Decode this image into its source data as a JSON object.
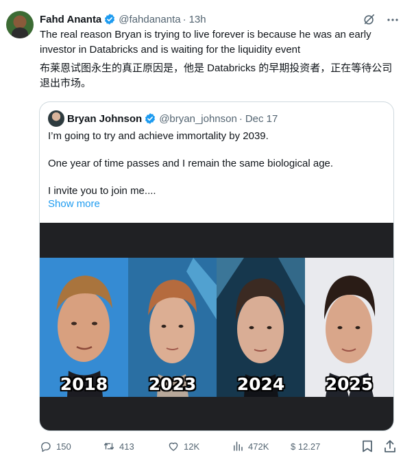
{
  "tweet": {
    "author_name": "Fahd Ananta",
    "author_handle": "@fahdananta",
    "separator": "·",
    "time": "13h",
    "text_en": "The real reason Bryan is trying to live forever is because he was an early investor in Databricks and is waiting for the liquidity event",
    "text_zh": "布莱恩试图永生的真正原因是，他是 Databricks 的早期投资者，正在等待公司退出市场。",
    "icons": {
      "verified": "verified-badge-icon",
      "grok": "grok-icon",
      "more": "more-icon"
    }
  },
  "quote": {
    "author_name": "Bryan Johnson",
    "author_handle": "@bryan_johnson",
    "separator": "·",
    "date": "Dec 17",
    "lines": [
      "I’m going to try and achieve immortality by 2039.",
      "One year of time passes and I remain the same biological age.",
      "I invite you to join me...."
    ],
    "show_more": "Show more",
    "media": {
      "years": [
        "2018",
        "2023",
        "2024",
        "2025"
      ]
    }
  },
  "actions": {
    "replies": "150",
    "reposts": "413",
    "likes": "12K",
    "views": "472K",
    "tip": "$ 12.27",
    "icons": [
      "reply-icon",
      "repost-icon",
      "like-icon",
      "views-icon",
      "bookmark-icon",
      "share-icon"
    ]
  },
  "colors": {
    "text": "#0f1419",
    "muted": "#536471",
    "link": "#1d9bf0",
    "verified": "#1d9bf0",
    "border": "#cfd9de",
    "media_bg": "#202124"
  }
}
